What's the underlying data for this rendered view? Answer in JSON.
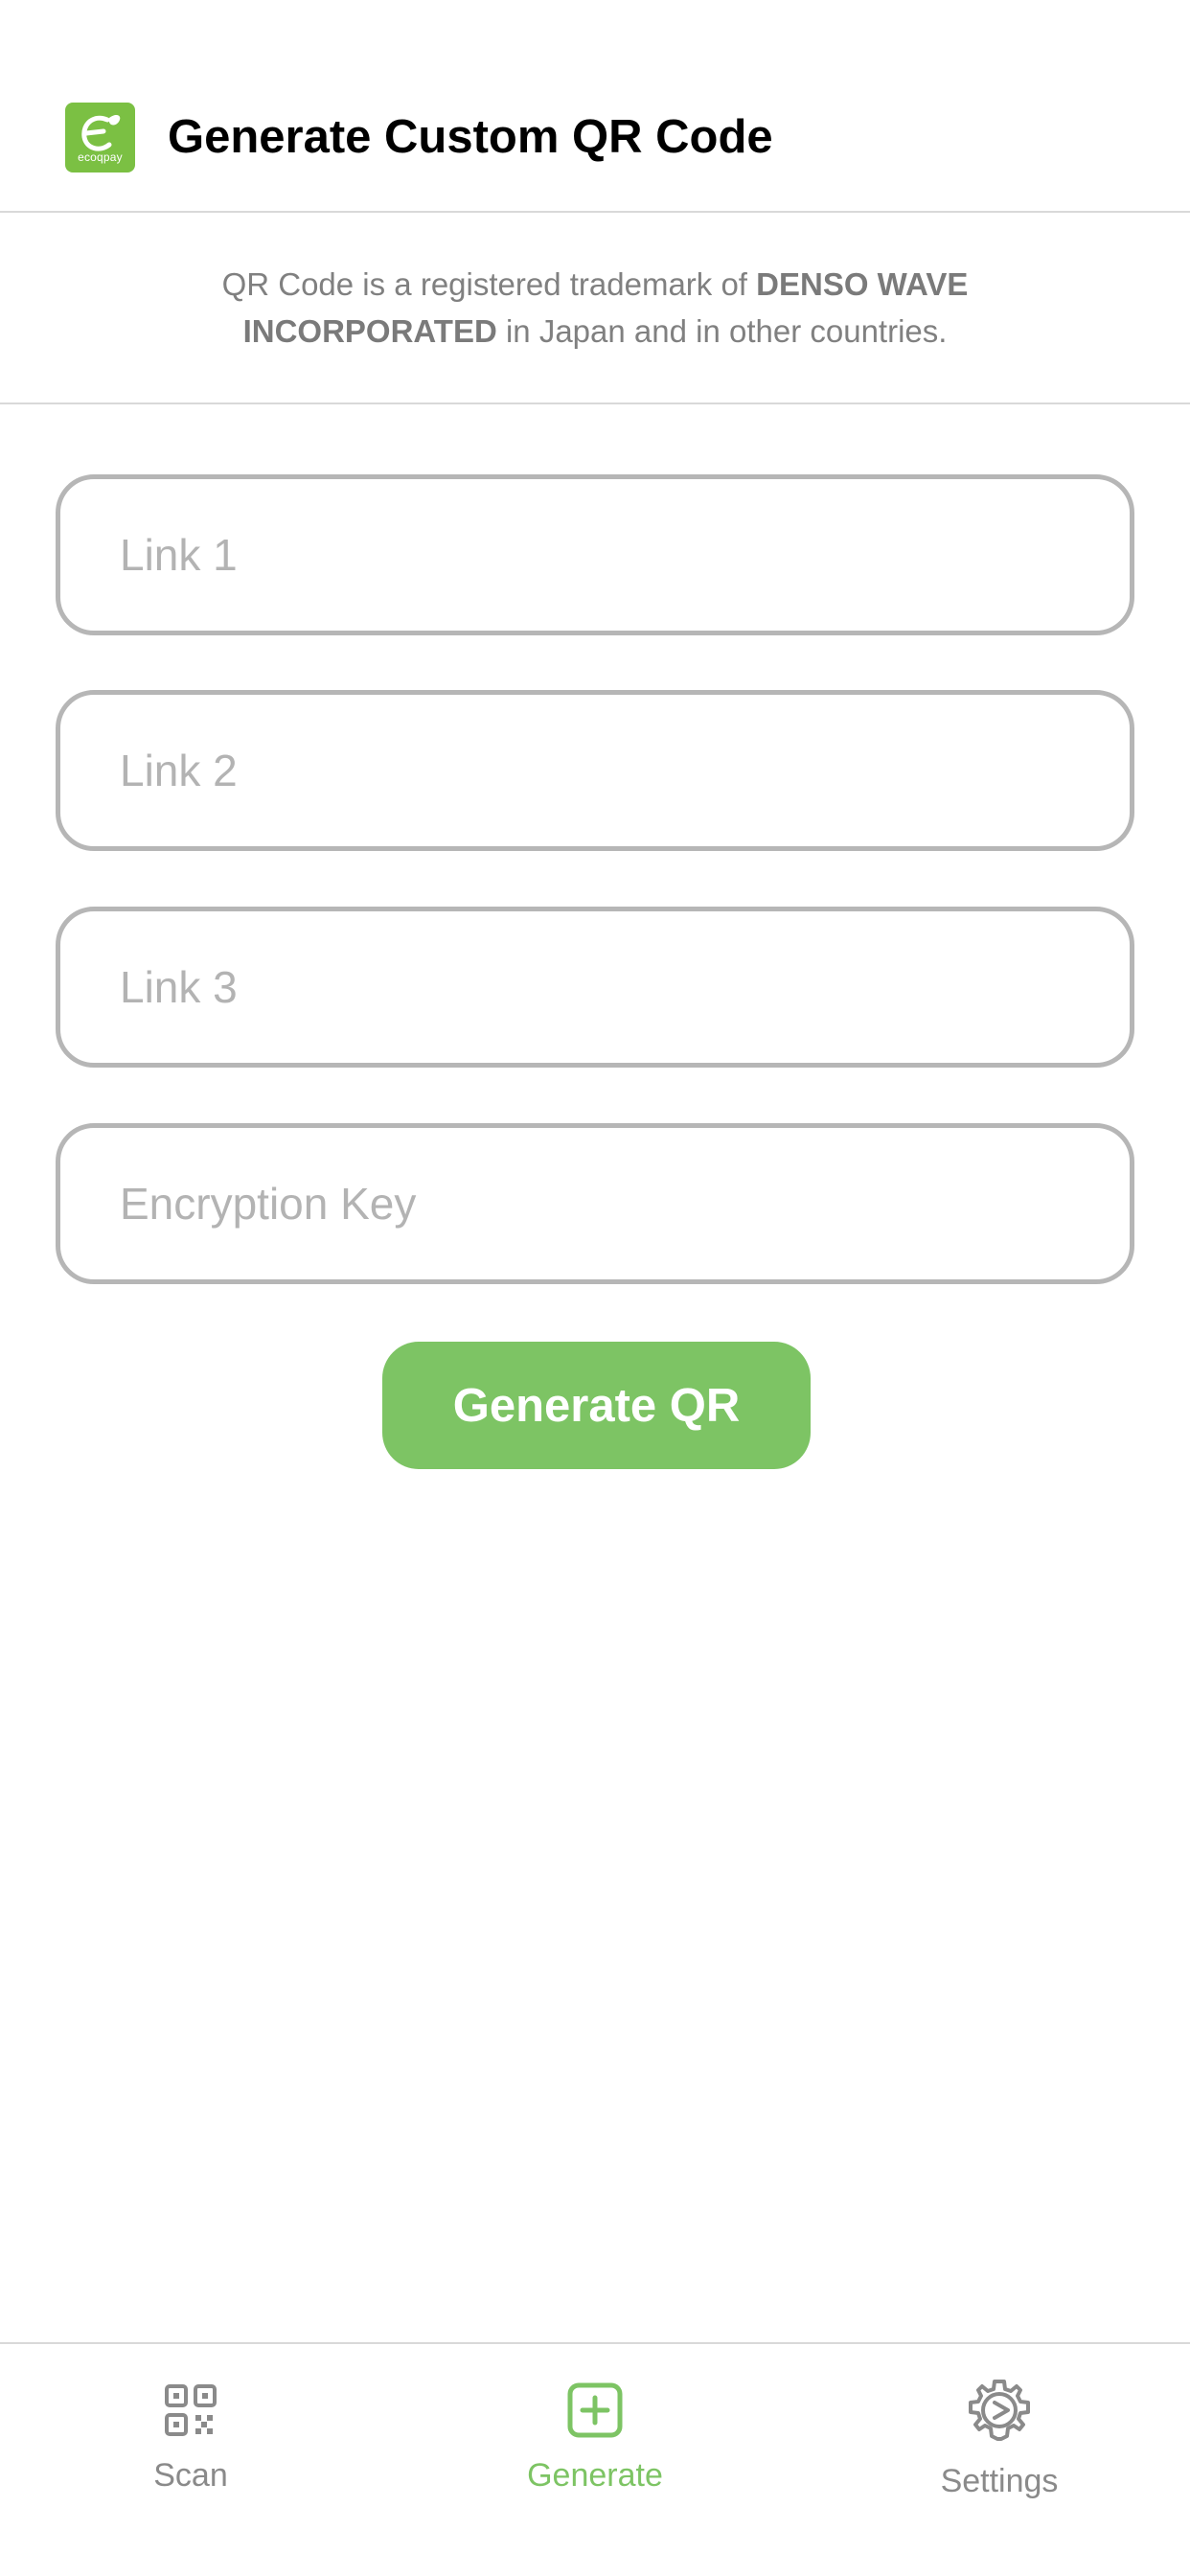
{
  "header": {
    "title": "Generate Custom QR Code",
    "logo_text": "ecoqpay",
    "logo_icon": "ecoqpay-logo-icon"
  },
  "notice": {
    "prefix": "QR Code is a registered trademark of ",
    "company": "DENSO WAVE INCORPORATED",
    "suffix": " in Japan and in other countries."
  },
  "form": {
    "link1": {
      "placeholder": "Link 1",
      "value": ""
    },
    "link2": {
      "placeholder": "Link 2",
      "value": ""
    },
    "link3": {
      "placeholder": "Link 3",
      "value": ""
    },
    "key": {
      "placeholder": "Encryption Key",
      "value": ""
    },
    "generate_label": "Generate QR"
  },
  "tabs": {
    "scan": {
      "label": "Scan",
      "icon": "qr-code-icon"
    },
    "generate": {
      "label": "Generate",
      "icon": "plus-square-icon",
      "active": true
    },
    "settings": {
      "label": "Settings",
      "icon": "gear-icon"
    }
  },
  "colors": {
    "accent": "#7dc464",
    "brand": "#7bc043",
    "field_border": "#b6b6b6",
    "placeholder": "#b3b3b3",
    "inactive_tab": "#8a8a8a"
  }
}
